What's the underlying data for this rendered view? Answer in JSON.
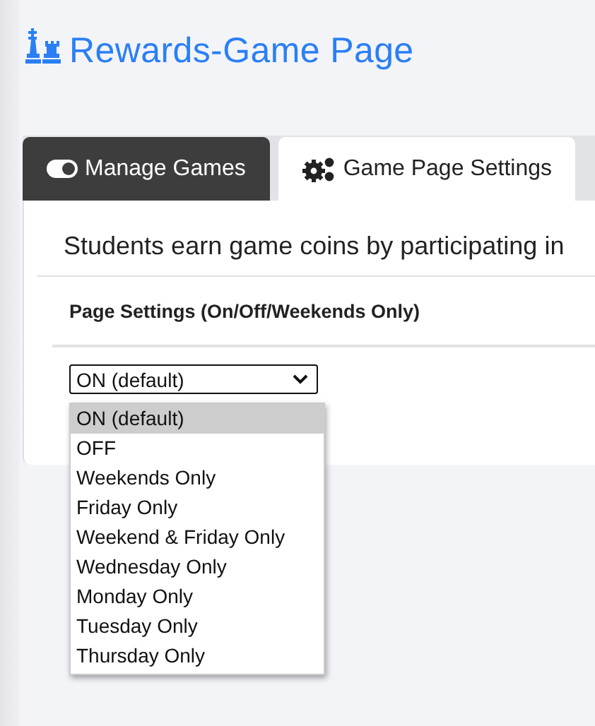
{
  "page": {
    "title": "Rewards-Game Page"
  },
  "tabs": [
    {
      "label": "Manage Games",
      "selected": false
    },
    {
      "label": "Game Page Settings",
      "selected": true
    }
  ],
  "intro": "Students earn game coins by participating in",
  "setting": {
    "label": "Page Settings (On/Off/Weekends Only)",
    "value": "ON (default)",
    "expanded": true,
    "options": [
      {
        "label": "ON (default)",
        "selected": true
      },
      {
        "label": "OFF",
        "selected": false
      },
      {
        "label": "Weekends Only",
        "selected": false
      },
      {
        "label": "Friday Only",
        "selected": false
      },
      {
        "label": "Weekend & Friday Only",
        "selected": false
      },
      {
        "label": "Wednesday Only",
        "selected": false
      },
      {
        "label": "Monday Only",
        "selected": false
      },
      {
        "label": "Tuesday Only",
        "selected": false
      },
      {
        "label": "Thursday Only",
        "selected": false
      }
    ]
  }
}
